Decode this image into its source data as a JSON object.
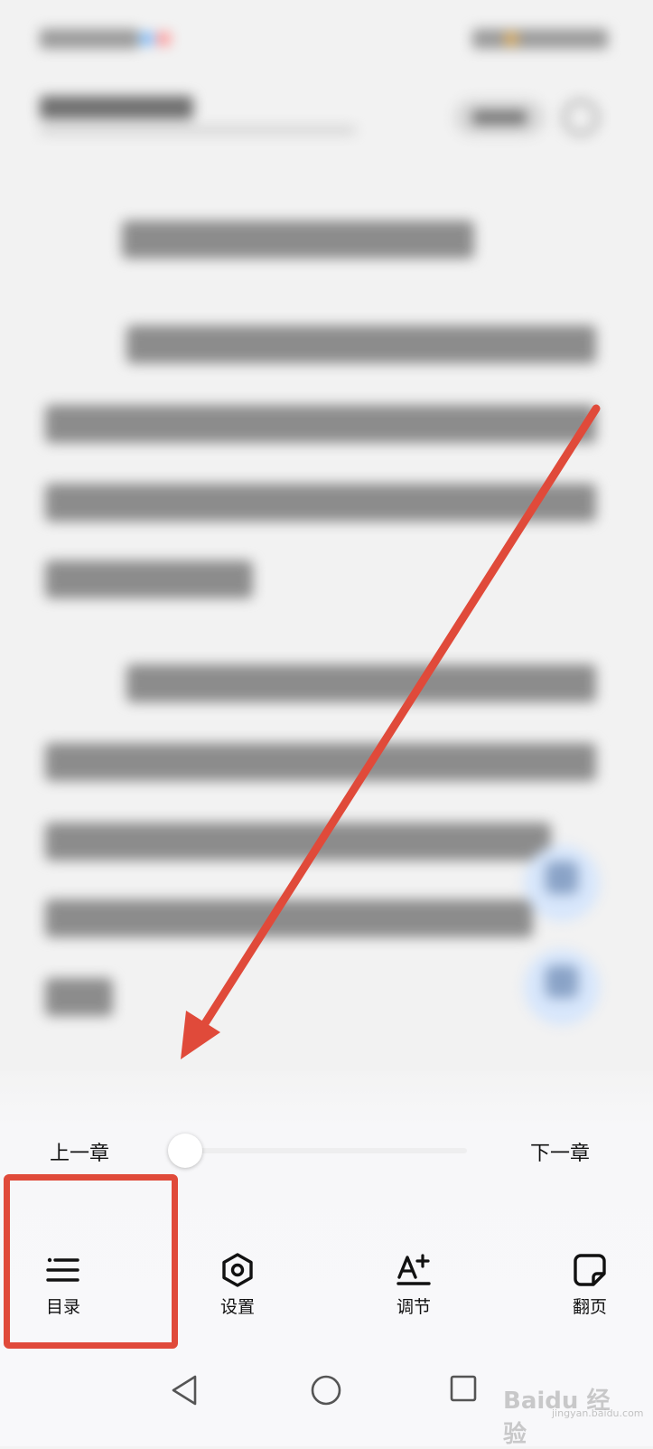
{
  "toolbar": {
    "prev_chapter": "上一章",
    "next_chapter": "下一章",
    "chapter_progress": 0.0,
    "items": [
      {
        "label": "目录",
        "icon": "list-icon"
      },
      {
        "label": "设置",
        "icon": "hexagon-settings-icon"
      },
      {
        "label": "调节",
        "icon": "font-size-icon"
      },
      {
        "label": "翻页",
        "icon": "page-turn-icon"
      }
    ]
  },
  "annotation": {
    "color": "#e04a3a"
  },
  "watermark": {
    "text": "Baidu 经验",
    "sub": "jingyan.baidu.com"
  },
  "colors": {
    "panel_background": "#f8f8fa",
    "slider_track": "#eeeeef"
  }
}
